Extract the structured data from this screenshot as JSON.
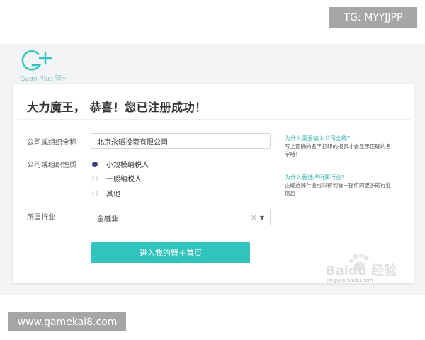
{
  "overlay": {
    "tg_label": "TG: MYYJJPP",
    "site_url": "www.gamekai8.com"
  },
  "brand": {
    "name": "Guan Plus 管+",
    "accent_color": "#31c4bf",
    "logo_icon": "g-plus-logo-icon"
  },
  "form": {
    "title": "大力魔王， 恭喜！您已注册成功！",
    "org_name": {
      "label": "公司或组织全称",
      "value": "北京永瑶投资有限公司"
    },
    "org_type": {
      "label": "公司或组织性质",
      "options": [
        {
          "label": "小规模纳税人",
          "selected": true
        },
        {
          "label": "一般纳税人",
          "selected": false
        },
        {
          "label": "其他",
          "selected": false
        }
      ]
    },
    "industry": {
      "label": "所属行业",
      "value": "金融业",
      "clear_icon": "close-icon",
      "caret_icon": "caret-down-icon"
    },
    "submit_label": "进入我的管＋首页"
  },
  "help": [
    {
      "question": "为什么需要输入公司全称？",
      "answer": "写上正确的名字打印的报表才会显示正确的名字哦！"
    },
    {
      "question": "为什么要选择所属行业？",
      "answer": "正确选择行业可以得到管＋提供的更多的行业信息"
    }
  ],
  "watermark": {
    "text": "Baidu 经验",
    "sub": "jingyan.baidu.com"
  }
}
